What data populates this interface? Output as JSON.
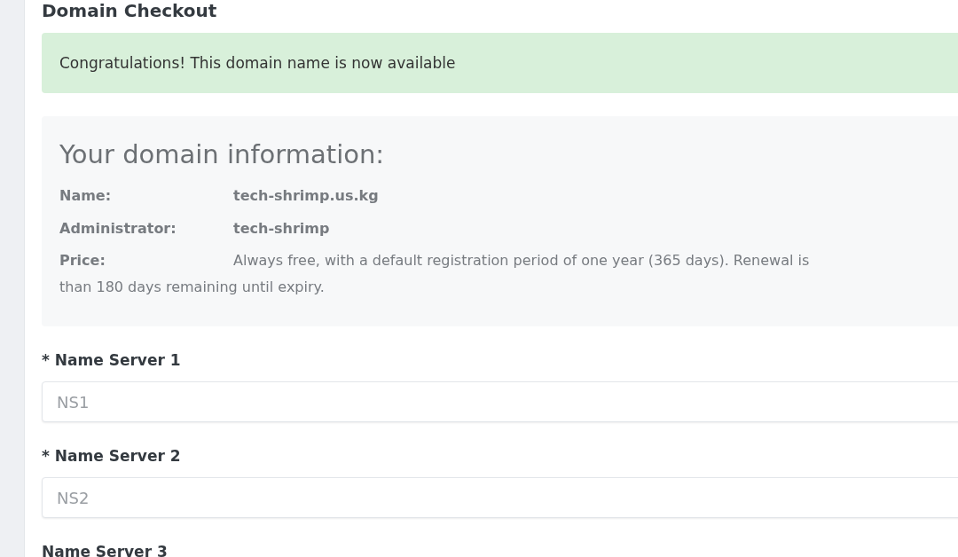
{
  "page_title": "Domain Checkout",
  "alert": {
    "message": "Congratulations! This domain name is now available"
  },
  "domain_info": {
    "title": "Your domain information:",
    "rows": [
      {
        "label": "Name:",
        "value": [
          "tech-shrimp.us.kg"
        ],
        "kind": "strong"
      },
      {
        "label": "Administrator:",
        "value": [
          "tech-shrimp"
        ],
        "kind": "strong"
      },
      {
        "label": "Price:",
        "value": [
          "Always free, with a default registration period of one year (365 days). Renewal is",
          "than 180 days remaining until expiry."
        ],
        "kind": "plain"
      }
    ]
  },
  "fields": [
    {
      "label": "* Name Server 1",
      "placeholder": "NS1"
    },
    {
      "label": "* Name Server 2",
      "placeholder": "NS2"
    },
    {
      "label": "Name Server 3"
    }
  ]
}
